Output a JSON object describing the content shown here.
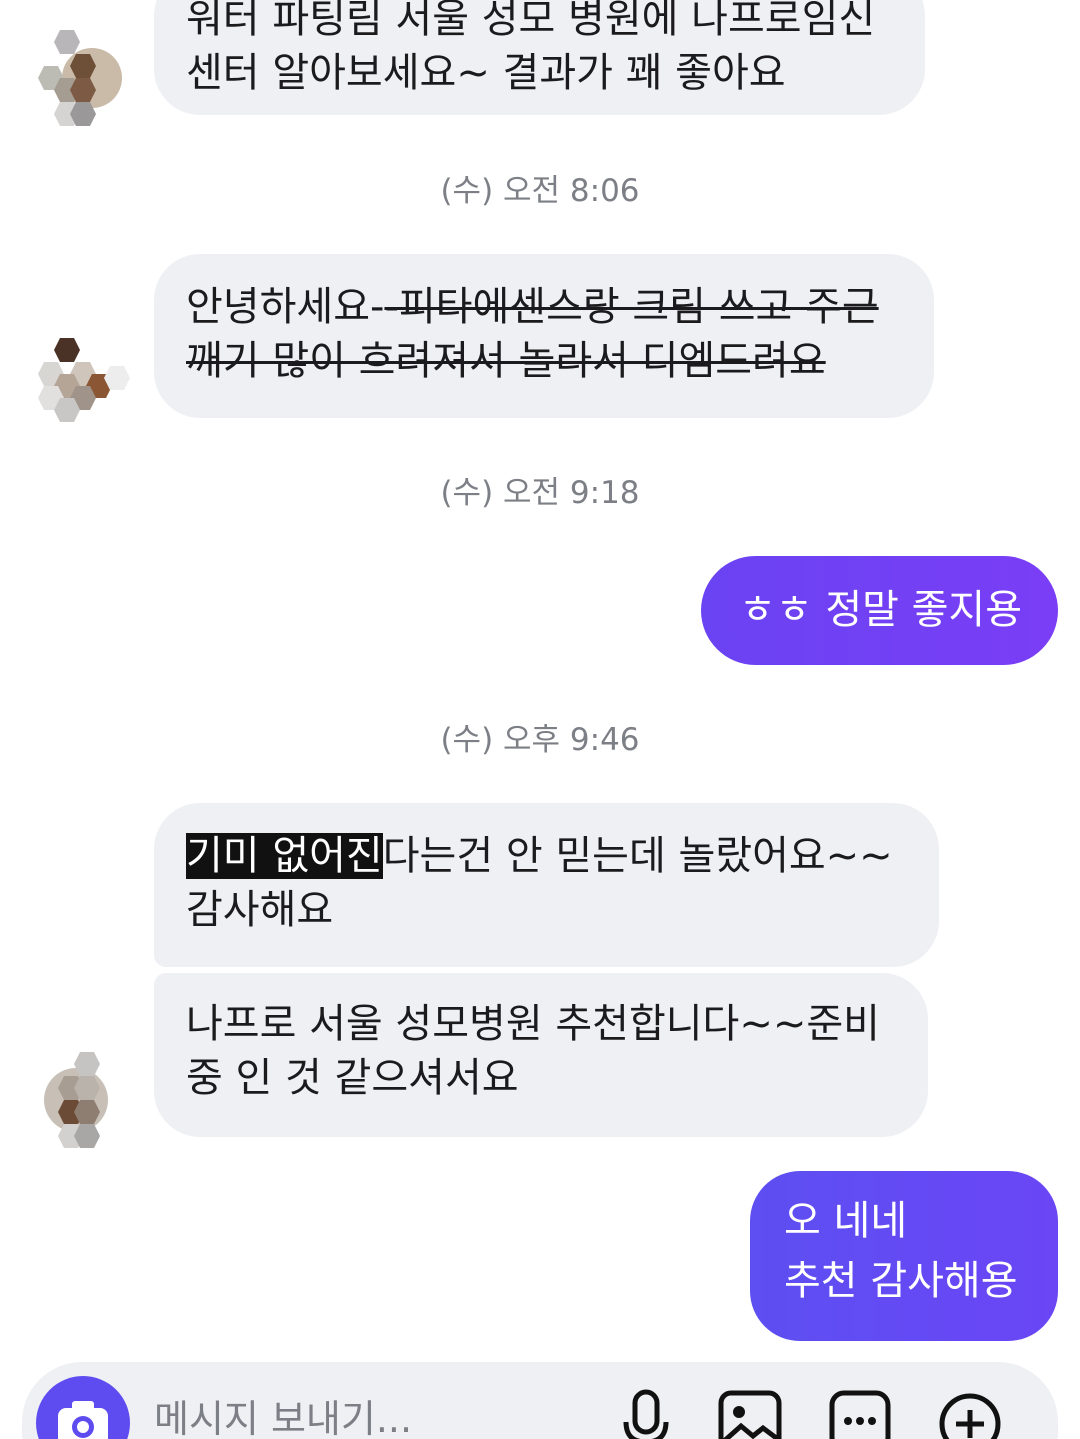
{
  "messages": [
    {
      "type": "incoming",
      "line1": "워터 파팅림 서울 성모 병원에 나프로임신",
      "line2": "센터 알아보세요~ 결과가 꽤 좋아요"
    },
    {
      "type": "timestamp",
      "text": "(수) 오전 8:06"
    },
    {
      "type": "incoming",
      "line1_plain": "안녕하세요-",
      "line1_strike": "-피타에센스랑 크림 쓰고 주근",
      "line2_strike": "깨기 많이 흐려져서 놀라서 디엠드려요"
    },
    {
      "type": "timestamp",
      "text": "(수) 오전 9:18"
    },
    {
      "type": "outgoing",
      "text": "ㅎㅎ 정말 좋지용"
    },
    {
      "type": "timestamp",
      "text": "(수) 오후 9:46"
    },
    {
      "type": "incoming",
      "highlight": "기미 없어진",
      "line1_rest": "다는건 안 믿는데 놀랐어요~~",
      "line2": "감사해요"
    },
    {
      "type": "incoming",
      "line1": "나프로 서울 성모병원 추천합니다~~준비",
      "line2": "중 인 것 같으셔서요"
    },
    {
      "type": "outgoing",
      "line1": "오 네네",
      "line2": "추천 감사해용"
    }
  ],
  "composer": {
    "placeholder": "메시지 보내기...",
    "icons": [
      "camera-icon",
      "microphone-icon",
      "image-icon",
      "sticker-icon",
      "plus-icon"
    ]
  },
  "colors": {
    "outgoing_bubble": "#6a43f2",
    "incoming_bubble": "#eff0f4",
    "timestamp": "#7c7f86",
    "camera_button": "#5e4cf1"
  }
}
